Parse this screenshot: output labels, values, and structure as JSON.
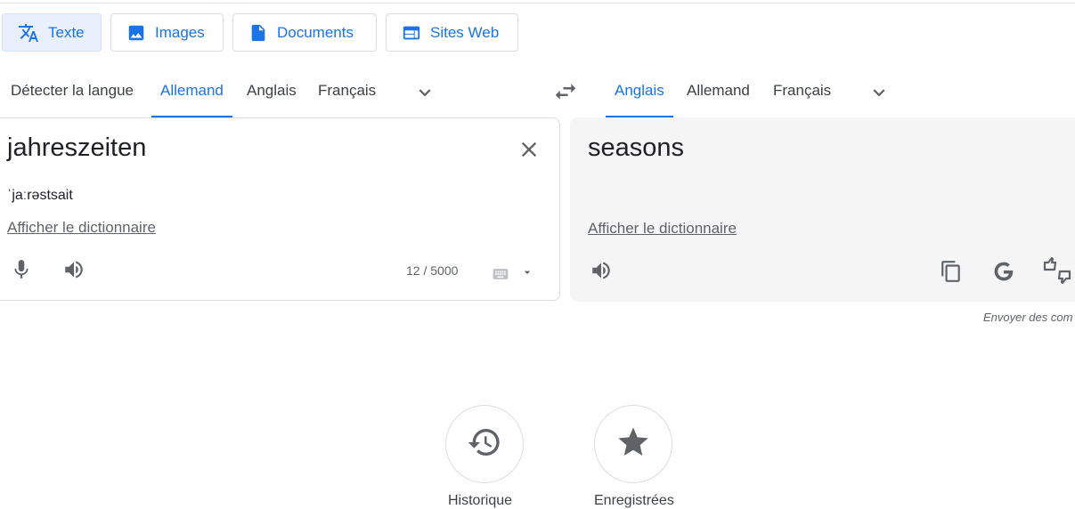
{
  "mode_tabs": [
    {
      "label": "Texte",
      "icon": "translate-icon",
      "active": true
    },
    {
      "label": "Images",
      "icon": "image-icon",
      "active": false
    },
    {
      "label": "Documents",
      "icon": "document-icon",
      "active": false
    },
    {
      "label": "Sites Web",
      "icon": "website-icon",
      "active": false
    }
  ],
  "source_languages": [
    "Détecter la langue",
    "Allemand",
    "Anglais",
    "Français"
  ],
  "source_selected": "Allemand",
  "target_languages": [
    "Anglais",
    "Allemand",
    "Français"
  ],
  "target_selected": "Anglais",
  "source": {
    "text": "jahreszeiten",
    "phonetic": "ˈjaːrəstsait",
    "dictionary_link": "Afficher le dictionnaire",
    "char_count": "12 / 5000"
  },
  "target": {
    "text": "seasons",
    "dictionary_link": "Afficher le dictionnaire"
  },
  "feedback_text": "Envoyer des com",
  "bottom": {
    "history_label": "Historique",
    "saved_label": "Enregistrées"
  },
  "colors": {
    "accent": "#1a73e8",
    "icon": "#5f6368",
    "panel_bg": "#f5f5f5"
  }
}
